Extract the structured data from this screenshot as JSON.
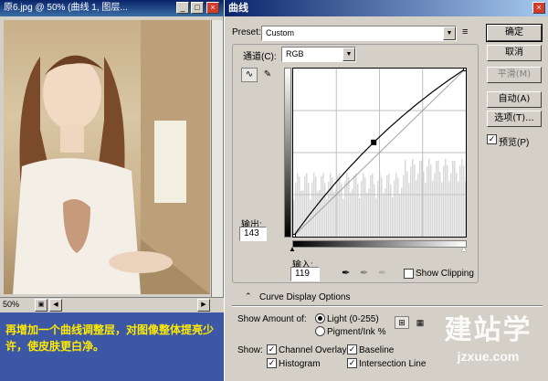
{
  "document_window": {
    "title": "原6.jpg @ 50% (曲线 1, 图层...",
    "minimize": "_",
    "restore": "□",
    "close": "×",
    "zoom": "50%"
  },
  "caption": {
    "text": "再增加一个曲线调整层，对图像整体提亮少许，使皮肤更白净。"
  },
  "curves_dialog": {
    "title": "曲线",
    "close": "×",
    "preset_label": "Preset:",
    "preset_value": "Custom",
    "channel_label": "通道(C):",
    "channel_value": "RGB",
    "output_label": "输出:",
    "output_value": "143",
    "input_label": "输入:",
    "input_value": "119",
    "show_clipping_label": "Show Clipping",
    "curve_display_options_label": "Curve Display Options",
    "show_amount_label": "Show Amount of:",
    "light_label": "Light  (0-255)",
    "pigment_label": "Pigment/Ink %",
    "show_label": "Show:",
    "channel_overlays_label": "Channel Overlays",
    "baseline_label": "Baseline",
    "histogram_label": "Histogram",
    "intersection_label": "Intersection Line",
    "buttons": {
      "ok": "确定",
      "cancel": "取消",
      "smooth": "平滑(M)",
      "auto": "自动(A)",
      "options": "选项(T)...",
      "preview": "预览(P)"
    },
    "checked": "✓"
  },
  "watermark": {
    "big": "建站学",
    "small": "jzxue.com"
  },
  "chart_data": {
    "type": "line",
    "title": "",
    "xlabel": "",
    "ylabel": "",
    "xlim": [
      0,
      255
    ],
    "ylim": [
      0,
      255
    ],
    "series": [
      {
        "values": [
          [
            0,
            0
          ],
          [
            119,
            143
          ],
          [
            255,
            255
          ]
        ]
      }
    ],
    "baseline": [
      [
        0,
        0
      ],
      [
        255,
        255
      ]
    ]
  }
}
